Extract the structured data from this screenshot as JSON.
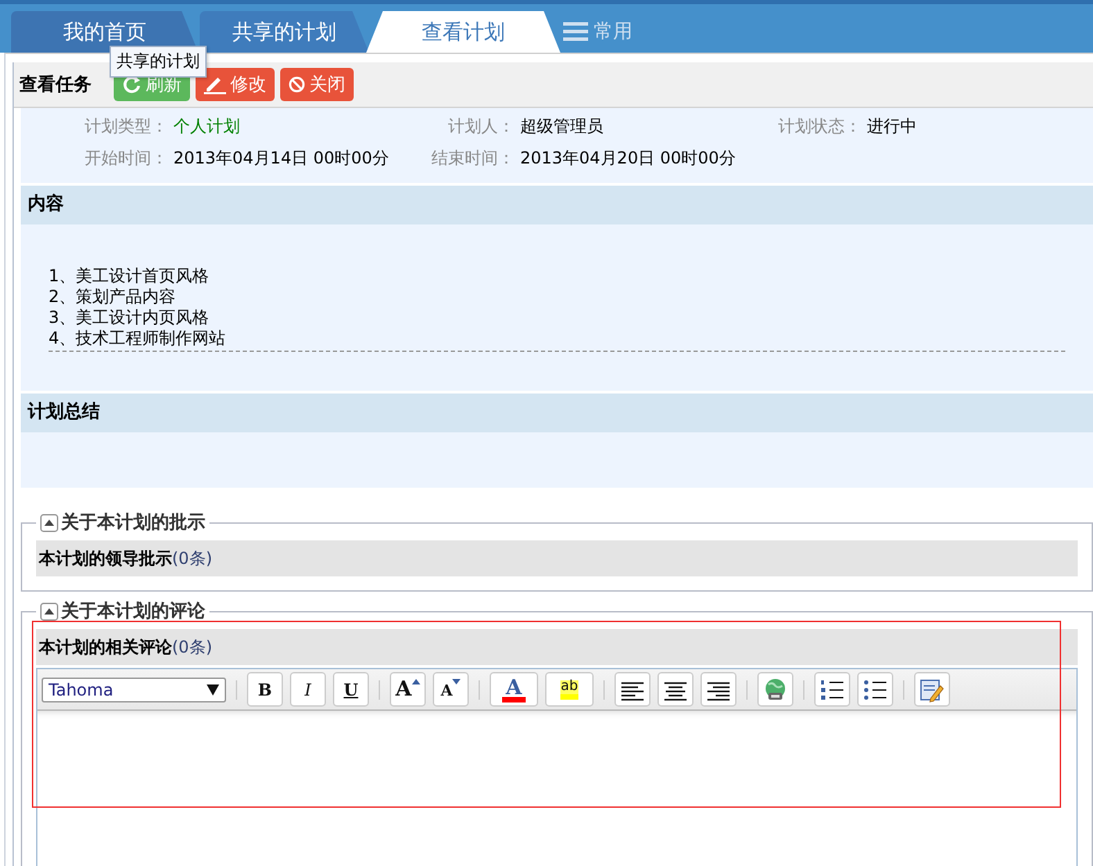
{
  "tabs": [
    {
      "label": "我的首页",
      "selected": false
    },
    {
      "label": "共享的计划",
      "selected": false
    },
    {
      "label": "查看计划",
      "selected": true
    }
  ],
  "shortcut": {
    "label": "常用"
  },
  "tooltip": "共享的计划",
  "toolbar": {
    "title": "查看任务",
    "buttons": [
      {
        "label": "刷新",
        "kind": "refresh"
      },
      {
        "label": "修改",
        "kind": "edit"
      },
      {
        "label": "关闭",
        "kind": "close"
      }
    ]
  },
  "info": [
    [
      {
        "label": "计划类型：",
        "value": "个人计划",
        "color": "#008000"
      },
      {
        "label": "计划人：",
        "value": "超级管理员",
        "color": "#000000"
      },
      {
        "label": "计划状态：",
        "value": "进行中",
        "color": "#000000"
      }
    ],
    [
      {
        "label": "开始时间：",
        "value": "2013年04月14日 00时00分",
        "color": "#000000"
      },
      {
        "label": "结束时间：",
        "value": "2013年04月20日 00时00分",
        "color": "#000000"
      }
    ]
  ],
  "sections": [
    {
      "title": "内容",
      "lines": [
        "1、美工设计首页风格",
        "2、策划产品内容",
        "3、美工设计内页风格",
        "4、技术工程师制作网站"
      ]
    },
    {
      "title": "计划总结"
    }
  ],
  "fieldsets": [
    {
      "legend": "关于本计划的批示",
      "header": "**本计划的领导批示**(0条)",
      "expanded": true
    },
    {
      "legend": "关于本计划的评论",
      "header": "**本计划的相关评论**(0条)",
      "expanded": true,
      "editor": {
        "tools": [
          {
            "kind": "font-select",
            "value": "Tahoma"
          },
          {
            "kind": "sep"
          },
          {
            "kind": "bold",
            "label": "B"
          },
          {
            "kind": "italic",
            "label": "I"
          },
          {
            "kind": "underline",
            "label": "U"
          },
          {
            "kind": "sep"
          },
          {
            "kind": "grow",
            "label": "A"
          },
          {
            "kind": "shrink",
            "label": "A"
          },
          {
            "kind": "sep"
          },
          {
            "kind": "font-color",
            "label": "A"
          },
          {
            "kind": "highlight",
            "label": "ab"
          },
          {
            "kind": "sep"
          },
          {
            "kind": "align-left"
          },
          {
            "kind": "align-center"
          },
          {
            "kind": "align-right"
          },
          {
            "kind": "sep"
          },
          {
            "kind": "link"
          },
          {
            "kind": "sep"
          },
          {
            "kind": "ordered-list"
          },
          {
            "kind": "bullet-list"
          },
          {
            "kind": "sep"
          },
          {
            "kind": "source"
          }
        ]
      }
    }
  ]
}
